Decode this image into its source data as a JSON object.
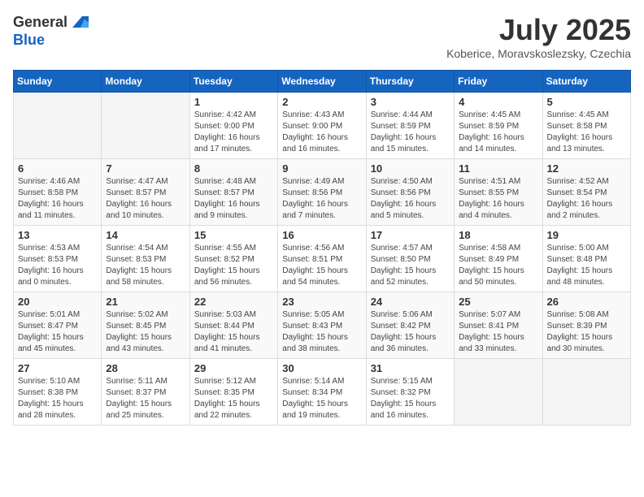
{
  "logo": {
    "general": "General",
    "blue": "Blue"
  },
  "header": {
    "month_year": "July 2025",
    "location": "Koberice, Moravskoslezsky, Czechia"
  },
  "weekdays": [
    "Sunday",
    "Monday",
    "Tuesday",
    "Wednesday",
    "Thursday",
    "Friday",
    "Saturday"
  ],
  "weeks": [
    [
      {
        "day": "",
        "info": ""
      },
      {
        "day": "",
        "info": ""
      },
      {
        "day": "1",
        "info": "Sunrise: 4:42 AM\nSunset: 9:00 PM\nDaylight: 16 hours and 17 minutes."
      },
      {
        "day": "2",
        "info": "Sunrise: 4:43 AM\nSunset: 9:00 PM\nDaylight: 16 hours and 16 minutes."
      },
      {
        "day": "3",
        "info": "Sunrise: 4:44 AM\nSunset: 8:59 PM\nDaylight: 16 hours and 15 minutes."
      },
      {
        "day": "4",
        "info": "Sunrise: 4:45 AM\nSunset: 8:59 PM\nDaylight: 16 hours and 14 minutes."
      },
      {
        "day": "5",
        "info": "Sunrise: 4:45 AM\nSunset: 8:58 PM\nDaylight: 16 hours and 13 minutes."
      }
    ],
    [
      {
        "day": "6",
        "info": "Sunrise: 4:46 AM\nSunset: 8:58 PM\nDaylight: 16 hours and 11 minutes."
      },
      {
        "day": "7",
        "info": "Sunrise: 4:47 AM\nSunset: 8:57 PM\nDaylight: 16 hours and 10 minutes."
      },
      {
        "day": "8",
        "info": "Sunrise: 4:48 AM\nSunset: 8:57 PM\nDaylight: 16 hours and 9 minutes."
      },
      {
        "day": "9",
        "info": "Sunrise: 4:49 AM\nSunset: 8:56 PM\nDaylight: 16 hours and 7 minutes."
      },
      {
        "day": "10",
        "info": "Sunrise: 4:50 AM\nSunset: 8:56 PM\nDaylight: 16 hours and 5 minutes."
      },
      {
        "day": "11",
        "info": "Sunrise: 4:51 AM\nSunset: 8:55 PM\nDaylight: 16 hours and 4 minutes."
      },
      {
        "day": "12",
        "info": "Sunrise: 4:52 AM\nSunset: 8:54 PM\nDaylight: 16 hours and 2 minutes."
      }
    ],
    [
      {
        "day": "13",
        "info": "Sunrise: 4:53 AM\nSunset: 8:53 PM\nDaylight: 16 hours and 0 minutes."
      },
      {
        "day": "14",
        "info": "Sunrise: 4:54 AM\nSunset: 8:53 PM\nDaylight: 15 hours and 58 minutes."
      },
      {
        "day": "15",
        "info": "Sunrise: 4:55 AM\nSunset: 8:52 PM\nDaylight: 15 hours and 56 minutes."
      },
      {
        "day": "16",
        "info": "Sunrise: 4:56 AM\nSunset: 8:51 PM\nDaylight: 15 hours and 54 minutes."
      },
      {
        "day": "17",
        "info": "Sunrise: 4:57 AM\nSunset: 8:50 PM\nDaylight: 15 hours and 52 minutes."
      },
      {
        "day": "18",
        "info": "Sunrise: 4:58 AM\nSunset: 8:49 PM\nDaylight: 15 hours and 50 minutes."
      },
      {
        "day": "19",
        "info": "Sunrise: 5:00 AM\nSunset: 8:48 PM\nDaylight: 15 hours and 48 minutes."
      }
    ],
    [
      {
        "day": "20",
        "info": "Sunrise: 5:01 AM\nSunset: 8:47 PM\nDaylight: 15 hours and 45 minutes."
      },
      {
        "day": "21",
        "info": "Sunrise: 5:02 AM\nSunset: 8:45 PM\nDaylight: 15 hours and 43 minutes."
      },
      {
        "day": "22",
        "info": "Sunrise: 5:03 AM\nSunset: 8:44 PM\nDaylight: 15 hours and 41 minutes."
      },
      {
        "day": "23",
        "info": "Sunrise: 5:05 AM\nSunset: 8:43 PM\nDaylight: 15 hours and 38 minutes."
      },
      {
        "day": "24",
        "info": "Sunrise: 5:06 AM\nSunset: 8:42 PM\nDaylight: 15 hours and 36 minutes."
      },
      {
        "day": "25",
        "info": "Sunrise: 5:07 AM\nSunset: 8:41 PM\nDaylight: 15 hours and 33 minutes."
      },
      {
        "day": "26",
        "info": "Sunrise: 5:08 AM\nSunset: 8:39 PM\nDaylight: 15 hours and 30 minutes."
      }
    ],
    [
      {
        "day": "27",
        "info": "Sunrise: 5:10 AM\nSunset: 8:38 PM\nDaylight: 15 hours and 28 minutes."
      },
      {
        "day": "28",
        "info": "Sunrise: 5:11 AM\nSunset: 8:37 PM\nDaylight: 15 hours and 25 minutes."
      },
      {
        "day": "29",
        "info": "Sunrise: 5:12 AM\nSunset: 8:35 PM\nDaylight: 15 hours and 22 minutes."
      },
      {
        "day": "30",
        "info": "Sunrise: 5:14 AM\nSunset: 8:34 PM\nDaylight: 15 hours and 19 minutes."
      },
      {
        "day": "31",
        "info": "Sunrise: 5:15 AM\nSunset: 8:32 PM\nDaylight: 15 hours and 16 minutes."
      },
      {
        "day": "",
        "info": ""
      },
      {
        "day": "",
        "info": ""
      }
    ]
  ]
}
